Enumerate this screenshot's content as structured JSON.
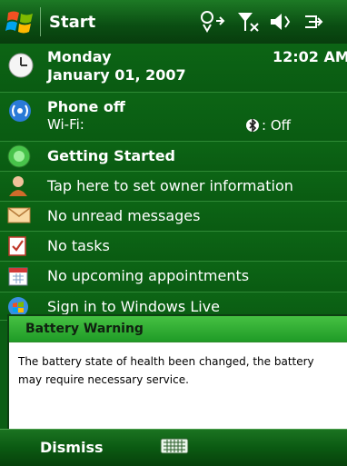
{
  "titlebar": {
    "title": "Start"
  },
  "today": {
    "datetime": {
      "day": "Monday",
      "date": "January 01, 2007",
      "time": "12:02 AM"
    },
    "phone": {
      "status": "Phone off",
      "wifi_label": "Wi-Fi:",
      "bluetooth_status": ": Off"
    },
    "items": [
      {
        "label": "Getting Started",
        "icon": "getting-started-icon"
      },
      {
        "label": "Tap here to set owner information",
        "icon": "owner-icon"
      },
      {
        "label": "No unread messages",
        "icon": "messages-icon"
      },
      {
        "label": "No tasks",
        "icon": "tasks-icon"
      },
      {
        "label": "No upcoming appointments",
        "icon": "calendar-icon"
      },
      {
        "label": "Sign in to Windows Live",
        "icon": "windows-live-icon"
      }
    ]
  },
  "notification": {
    "title": "Battery Warning",
    "message": "The battery state of health been changed, the battery may require necessary service."
  },
  "softkeys": {
    "left": "Dismiss",
    "sip": "keyboard-icon"
  },
  "colors": {
    "background": "#0b5d14",
    "header_green": "#3fbf3f",
    "text": "#ffffff"
  }
}
